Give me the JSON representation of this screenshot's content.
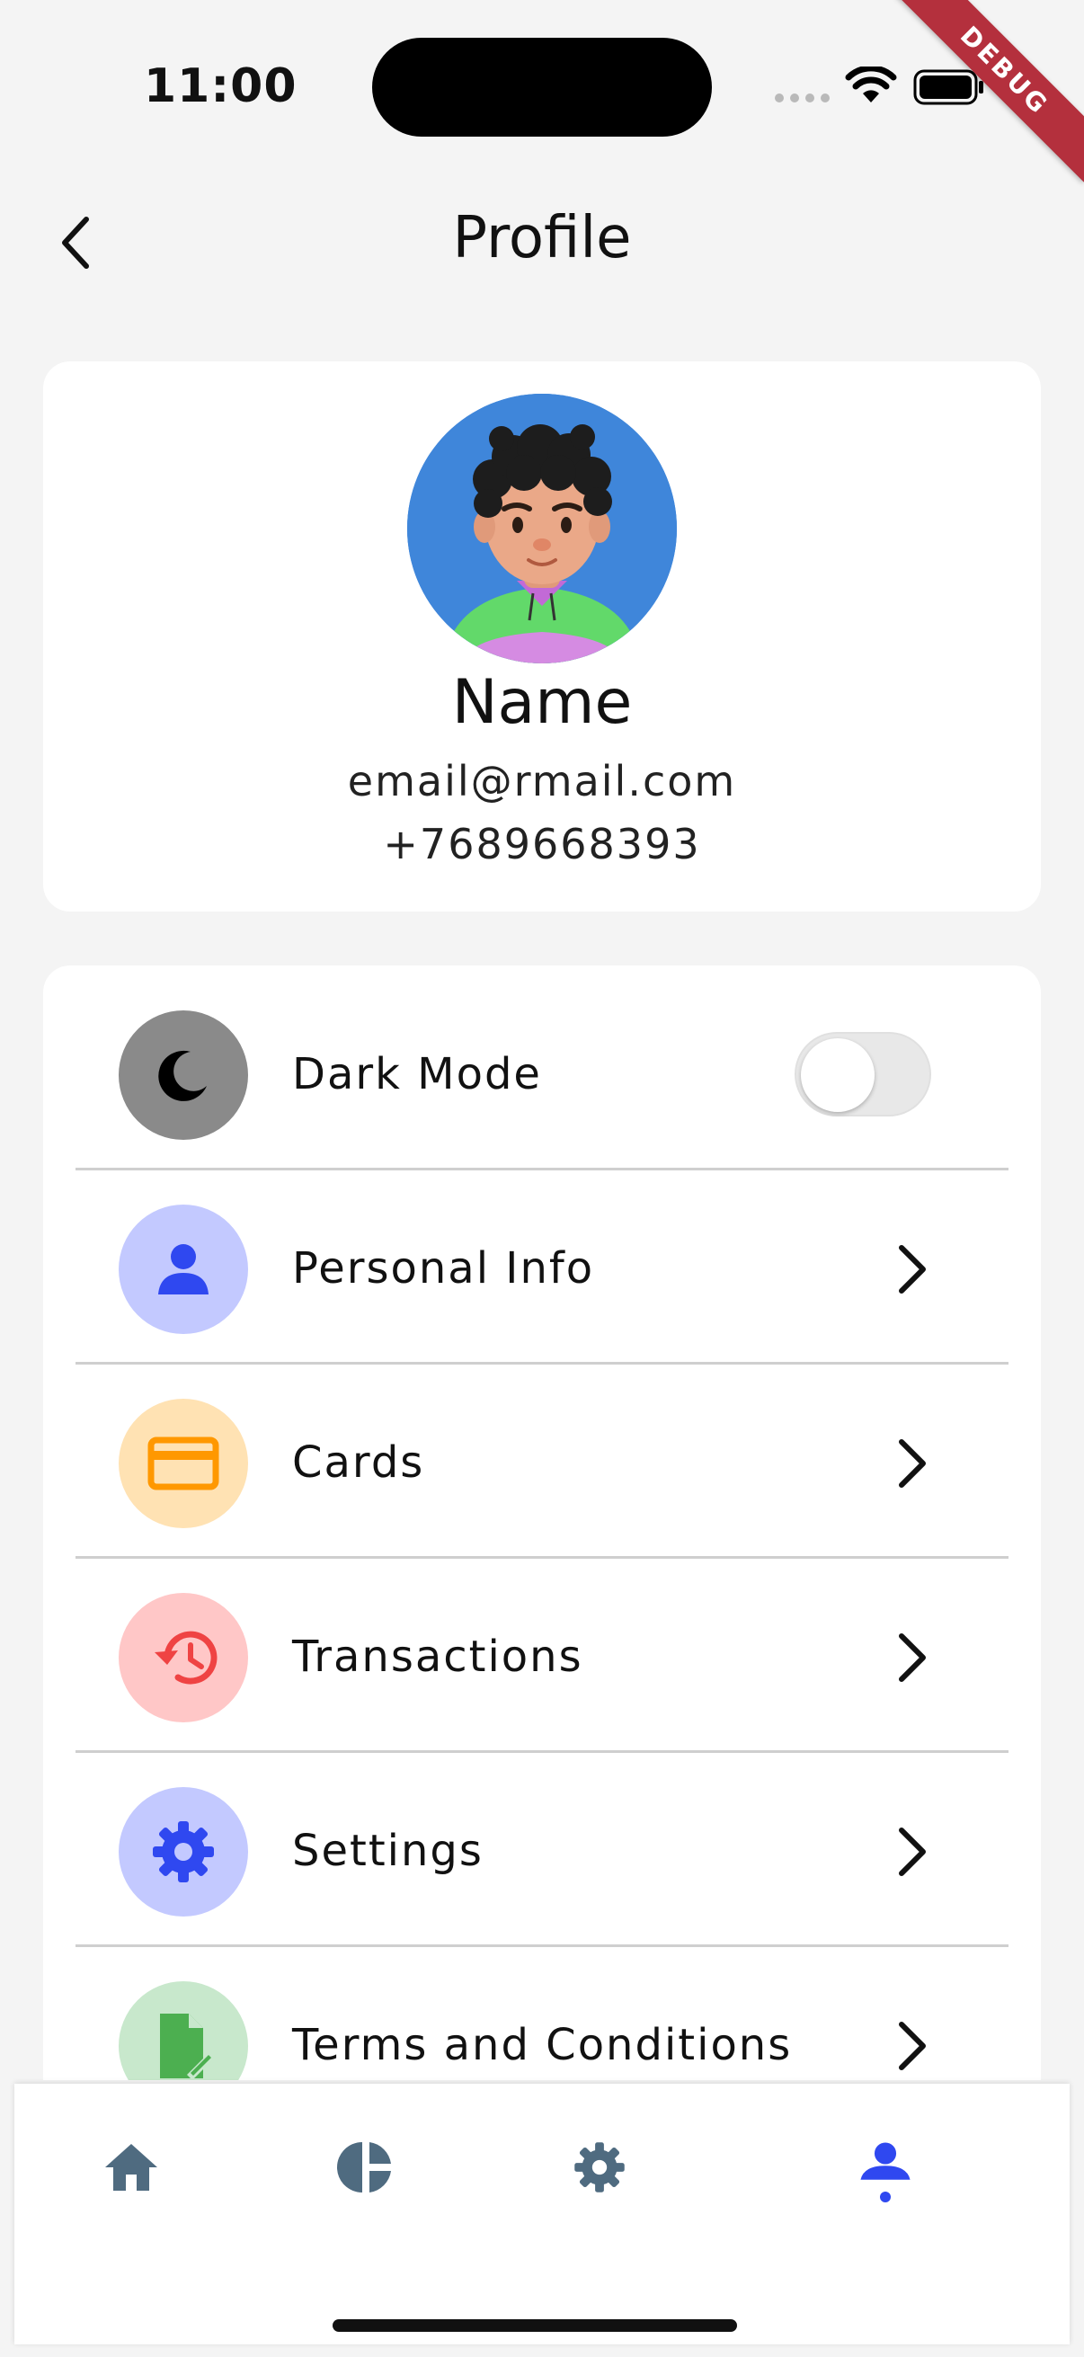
{
  "status_bar": {
    "time": "11:00",
    "debug_label": "DEBUG"
  },
  "header": {
    "title": "Profile",
    "back_icon": "chevron-left-icon"
  },
  "profile": {
    "name": "Name",
    "email": "email@rmail.com",
    "phone": "+7689668393"
  },
  "menu": {
    "items": [
      {
        "label": "Dark Mode",
        "icon": "moon-icon",
        "icon_bg": "#8a8a8a",
        "icon_color": "#000000",
        "control": "toggle",
        "toggle_on": false
      },
      {
        "label": "Personal Info",
        "icon": "person-icon",
        "icon_bg": "#c3c9ff",
        "icon_color": "#2f48f0",
        "control": "chevron"
      },
      {
        "label": "Cards",
        "icon": "credit-card-icon",
        "icon_bg": "#ffe2b3",
        "icon_color": "#ff9800",
        "control": "chevron"
      },
      {
        "label": "Transactions",
        "icon": "history-icon",
        "icon_bg": "#ffc7c7",
        "icon_color": "#ef4343",
        "control": "chevron"
      },
      {
        "label": "Settings",
        "icon": "gear-icon",
        "icon_bg": "#c3c9ff",
        "icon_color": "#2f48f0",
        "control": "chevron"
      },
      {
        "label": "Terms and Conditions",
        "icon": "document-edit-icon",
        "icon_bg": "#c8e8cc",
        "icon_color": "#4caf50",
        "control": "chevron"
      }
    ]
  },
  "bottom_nav": {
    "items": [
      {
        "icon": "home-icon",
        "active": false
      },
      {
        "icon": "pie-chart-icon",
        "active": false
      },
      {
        "icon": "gear-icon",
        "active": false
      },
      {
        "icon": "person-icon",
        "active": true
      }
    ],
    "inactive_color": "#4f6b80",
    "active_color": "#2f48f0"
  }
}
